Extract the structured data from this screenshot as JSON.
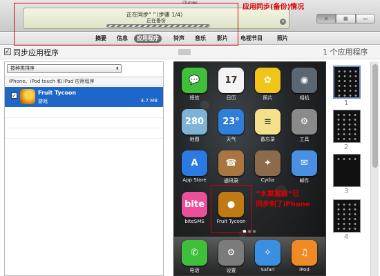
{
  "window": {
    "title": "iTunes"
  },
  "lcd": {
    "status": "正在同步“   ”（步骤 1/4）",
    "substatus": "正在备份",
    "cancel_icon": "×"
  },
  "view_buttons": [
    "list-view-icon",
    "grid-view-icon",
    "coverflow-view-icon"
  ],
  "tabs": [
    "摘要",
    "信息",
    "应用程序",
    "铃声",
    "音乐",
    "影片",
    "电视节目",
    "照片"
  ],
  "active_tab": "应用程序",
  "annotations": {
    "sync_status": "应用同步(备份)情况",
    "fruit_line1": "“水果富翁”已",
    "fruit_line2": "同步到了iPhone"
  },
  "sync_apps": {
    "label": "同步应用程序",
    "checked": true,
    "count_label": "1 个应用程序"
  },
  "sort": {
    "value": "按种类排序"
  },
  "list": {
    "header": "iPhone、iPod touch 和 iPad 应用程序",
    "rows": [
      {
        "name": "Fruit Tycoon",
        "category": "游戏",
        "size": "4.7 MB",
        "checked": true
      }
    ]
  },
  "home_screen": {
    "apps": [
      {
        "label": "短信",
        "icon": "message-icon",
        "color": "#3fbf3a",
        "glyph": "💬"
      },
      {
        "label": "日历",
        "icon": "calendar-icon",
        "color": "#f4f4f4",
        "glyph": "17"
      },
      {
        "label": "照片",
        "icon": "photos-icon",
        "color": "#f0c419",
        "glyph": "✿"
      },
      {
        "label": "相机",
        "icon": "camera-icon",
        "color": "#5b6672",
        "glyph": "◉"
      },
      {
        "label": "地图",
        "icon": "maps-icon",
        "color": "#7fb3d6",
        "glyph": "280"
      },
      {
        "label": "天气",
        "icon": "weather-icon",
        "color": "#2f7fd9",
        "glyph": "23°"
      },
      {
        "label": "备忘录",
        "icon": "notes-icon",
        "color": "#f4e08a",
        "glyph": "≡"
      },
      {
        "label": "工具",
        "icon": "tools-icon",
        "color": "#8a8a8a",
        "glyph": "⚙"
      },
      {
        "label": "App Store",
        "icon": "app-store-icon",
        "color": "#2a7ae2",
        "glyph": "A"
      },
      {
        "label": "通讯录",
        "icon": "contacts-icon",
        "color": "#a9763f",
        "glyph": "☎"
      },
      {
        "label": "Cydia",
        "icon": "cydia-icon",
        "color": "#8b6b4b",
        "glyph": "✦"
      },
      {
        "label": "邮件",
        "icon": "mail-icon",
        "color": "#4a90e2",
        "glyph": "✉"
      },
      {
        "label": "biteSMS",
        "icon": "bitesms-icon",
        "color": "#e94f9b",
        "glyph": "bite"
      },
      {
        "label": "Fruit Tycoon",
        "icon": "fruit-tycoon-icon",
        "color": "#c07a14",
        "glyph": "●"
      }
    ],
    "dock": [
      {
        "label": "电话",
        "icon": "phone-icon",
        "color": "#3fbf3a",
        "glyph": "✆"
      },
      {
        "label": "设置",
        "icon": "settings-icon",
        "color": "#7b7b7b",
        "glyph": "⚙"
      },
      {
        "label": "Safari",
        "icon": "safari-icon",
        "color": "#3b8fe0",
        "glyph": "✧"
      },
      {
        "label": "iPod",
        "icon": "ipod-icon",
        "color": "#f08a24",
        "glyph": "♫"
      }
    ]
  },
  "pages": [
    "1",
    "2",
    "3",
    "4"
  ]
}
